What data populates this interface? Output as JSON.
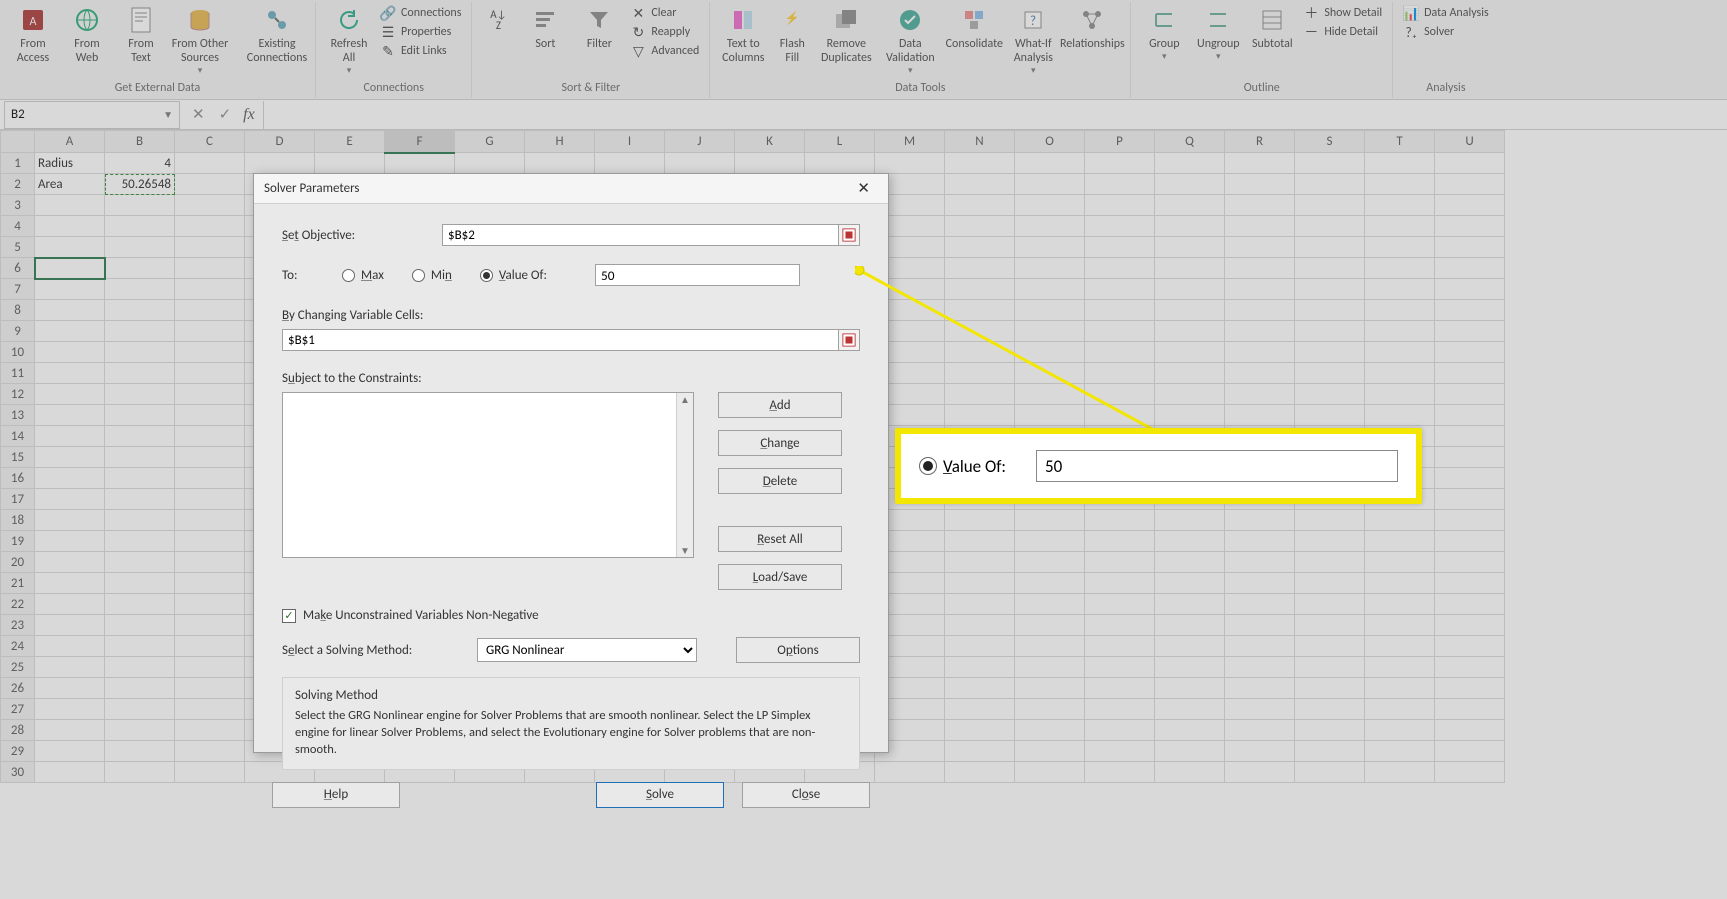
{
  "namebox": "B2",
  "formula": "",
  "ribbon": {
    "groups": {
      "get_external_data": "Get External Data",
      "connections": "Connections",
      "sort_filter": "Sort & Filter",
      "data_tools": "Data Tools",
      "outline": "Outline",
      "analysis": "Analysis"
    },
    "from_access": "From\nAccess",
    "from_web": "From\nWeb",
    "from_text": "From\nText",
    "from_other": "From Other\nSources",
    "existing_connections": "Existing\nConnections",
    "refresh_all": "Refresh\nAll",
    "conn_connections": "Connections",
    "conn_properties": "Properties",
    "conn_edit_links": "Edit Links",
    "sort": "Sort",
    "filter": "Filter",
    "clear": "Clear",
    "reapply": "Reapply",
    "advanced": "Advanced",
    "text_to_columns": "Text to\nColumns",
    "flash_fill": "Flash\nFill",
    "remove_duplicates": "Remove\nDuplicates",
    "data_validation": "Data\nValidation",
    "consolidate": "Consolidate",
    "what_if": "What-If\nAnalysis",
    "relationships": "Relationships",
    "group": "Group",
    "ungroup": "Ungroup",
    "subtotal": "Subtotal",
    "show_detail": "Show Detail",
    "hide_detail": "Hide Detail",
    "data_analysis": "Data Analysis",
    "solver": "Solver"
  },
  "columns": [
    "A",
    "B",
    "C",
    "D",
    "E",
    "F",
    "G",
    "H",
    "I",
    "J",
    "K",
    "L",
    "M",
    "N",
    "O",
    "P",
    "Q",
    "R",
    "S",
    "T",
    "U"
  ],
  "row_count": 30,
  "cells": {
    "A1": "Radius",
    "B1": "4",
    "A2": "Area",
    "B2": "50.26548"
  },
  "dialog": {
    "title": "Solver Parameters",
    "set_objective_label": "Set Objective:",
    "set_objective_value": "$B$2",
    "to_label": "To:",
    "opt_max": "Max",
    "opt_min": "Min",
    "opt_valueof": "Value Of:",
    "valueof_value": "50",
    "changing_label": "By Changing Variable Cells:",
    "changing_value": "$B$1",
    "constraints_label": "Subject to the Constraints:",
    "btn_add": "Add",
    "btn_change": "Change",
    "btn_delete": "Delete",
    "btn_resetall": "Reset All",
    "btn_loadsave": "Load/Save",
    "chk_nonneg": "Make Unconstrained Variables Non-Negative",
    "method_label": "Select a Solving Method:",
    "method_value": "GRG Nonlinear",
    "btn_options": "Options",
    "info_title": "Solving Method",
    "info_body": "Select the GRG Nonlinear engine for Solver Problems that are smooth nonlinear. Select the LP Simplex engine for linear Solver Problems, and select the Evolutionary engine for Solver problems that are non-smooth.",
    "btn_help": "Help",
    "btn_solve": "Solve",
    "btn_close": "Close"
  },
  "callout": {
    "label": "Value Of:",
    "value": "50"
  }
}
